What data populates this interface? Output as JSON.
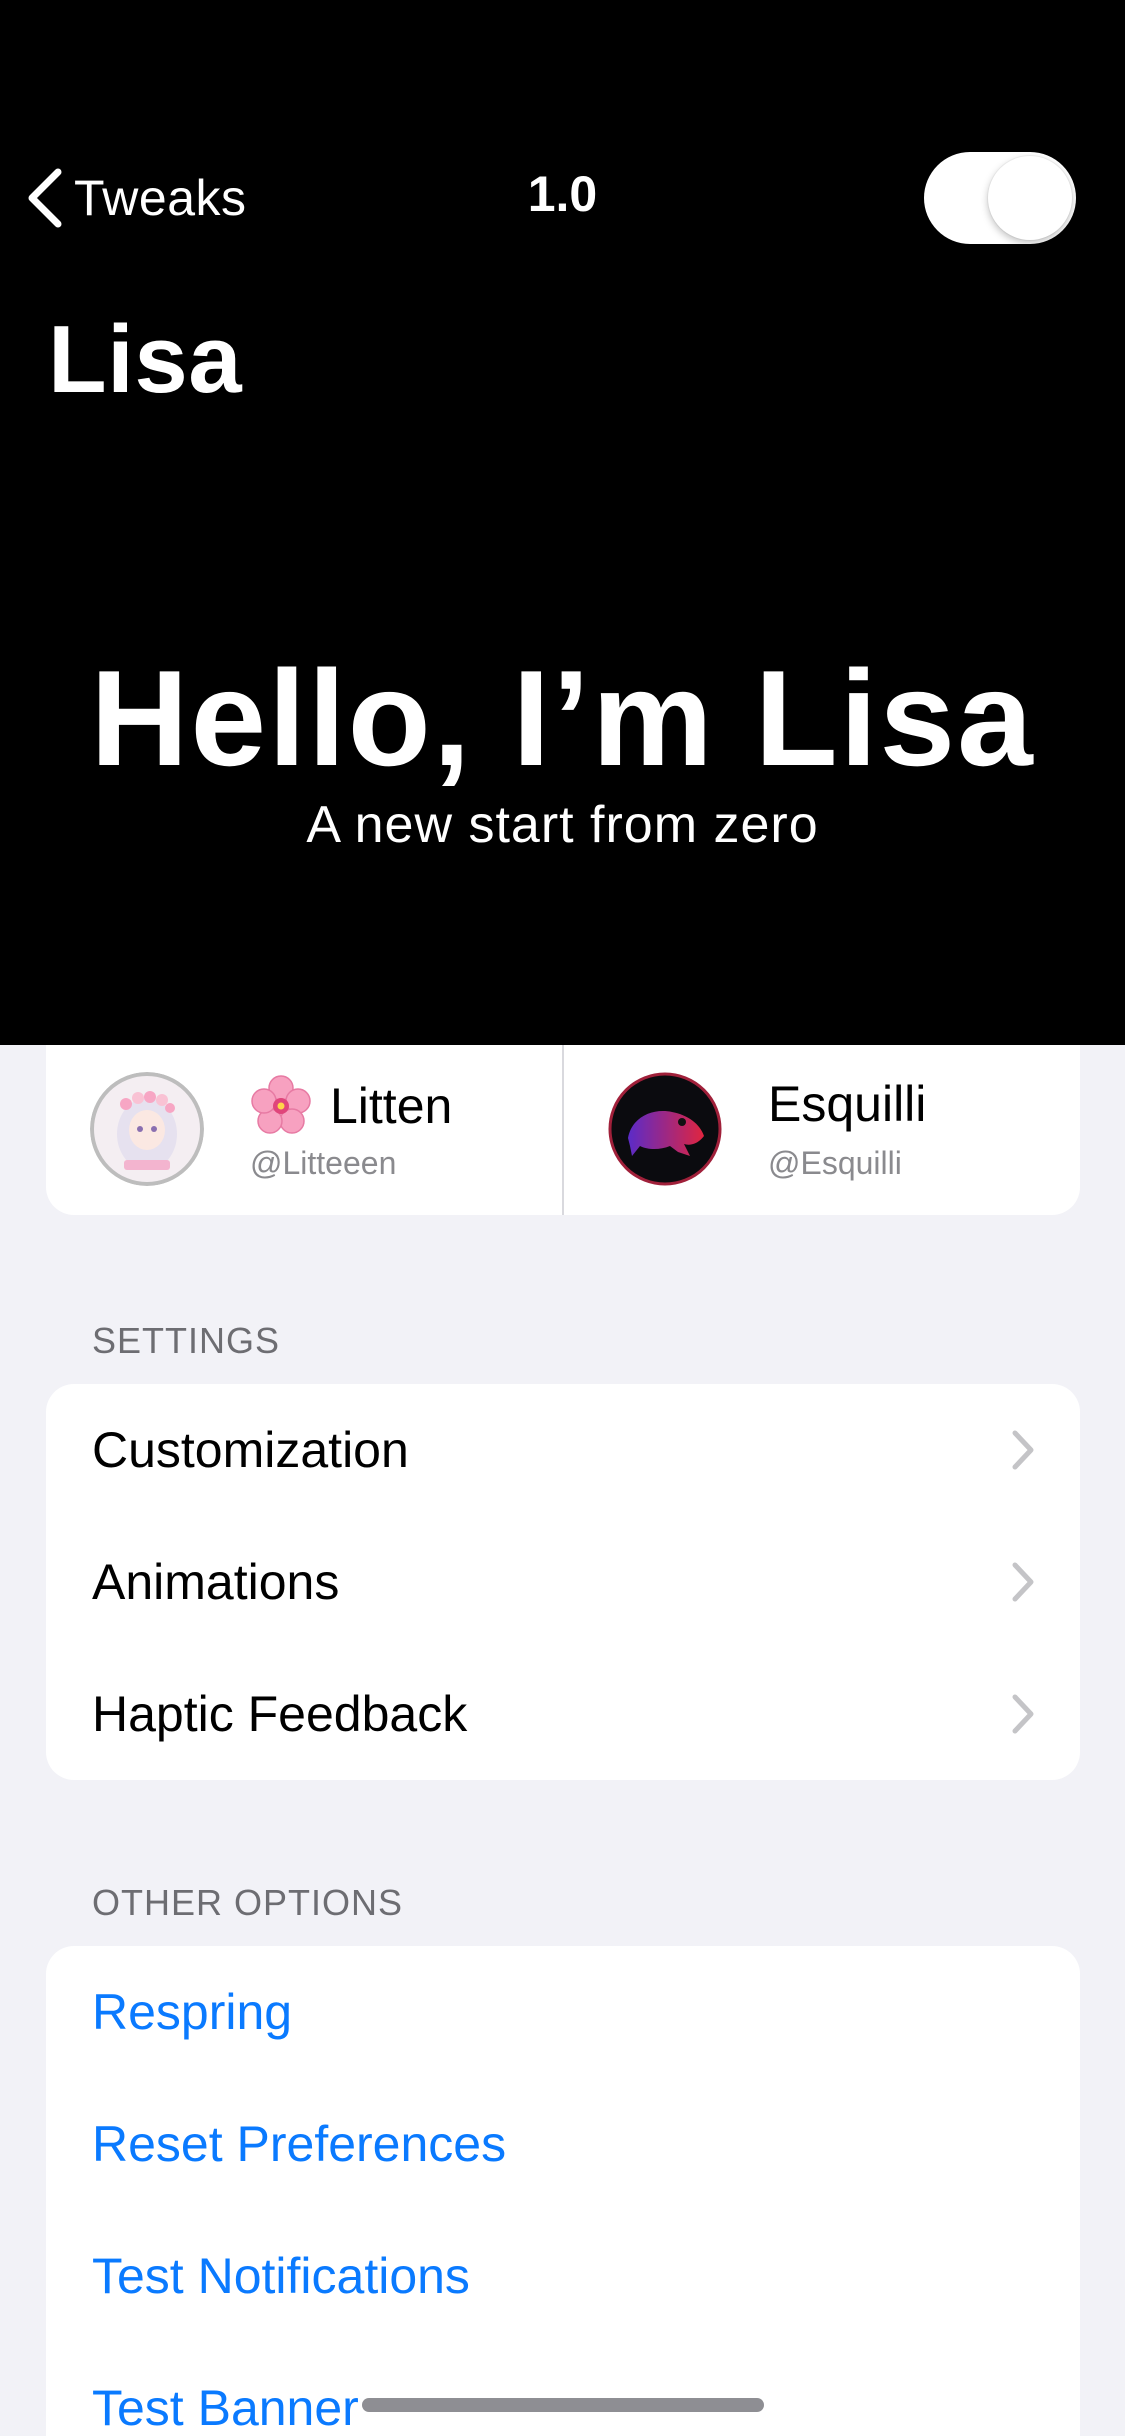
{
  "nav": {
    "back_label": "Tweaks",
    "version": "1.0",
    "toggle_on": true
  },
  "header": {
    "title": "Lisa",
    "hero_title": "Hello, I’m Lisa",
    "hero_subtitle": "A new start from zero"
  },
  "credits": [
    {
      "name": "Litten",
      "handle": "@Litteeen",
      "emoji": "🌸",
      "avatar": "anime-girl-avatar"
    },
    {
      "name": "Esquilli",
      "handle": "@Esquilli",
      "avatar": "frog-avatar"
    }
  ],
  "settings": {
    "header": "SETTINGS",
    "items": [
      {
        "label": "Customization"
      },
      {
        "label": "Animations"
      },
      {
        "label": "Haptic Feedback"
      }
    ]
  },
  "other_options": {
    "header": "OTHER OPTIONS",
    "items": [
      {
        "label": "Respring"
      },
      {
        "label": "Reset Preferences"
      },
      {
        "label": "Test Notifications"
      },
      {
        "label": "Test Banner"
      }
    ]
  },
  "colors": {
    "header_bg": "#000000",
    "page_bg": "#f2f2f7",
    "link": "#0a7aff",
    "secondary_text": "#8a8a8e"
  }
}
